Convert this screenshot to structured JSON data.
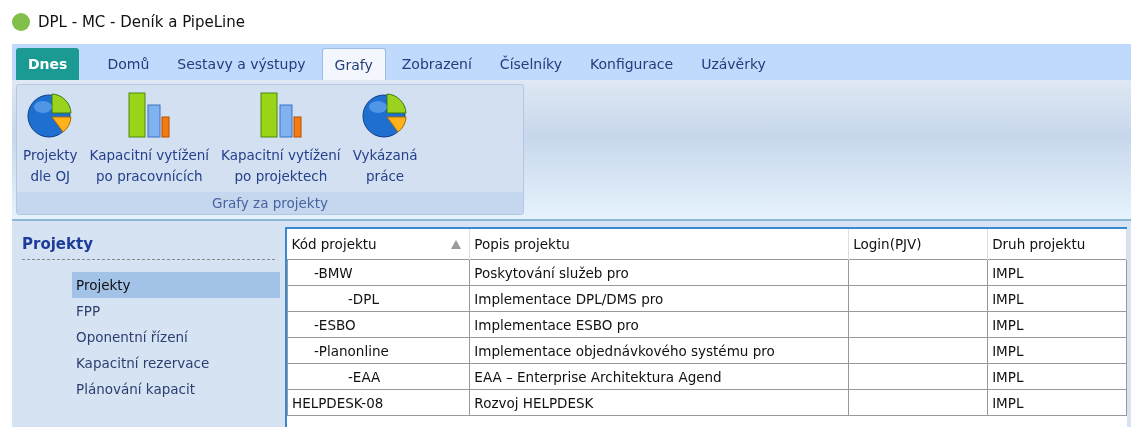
{
  "window": {
    "title": "DPL - MC - Deník a PipeLine"
  },
  "tabs": [
    {
      "label": "Dnes",
      "kind": "app",
      "selected": false
    },
    {
      "label": "Domů",
      "kind": "tab",
      "selected": false
    },
    {
      "label": "Sestavy a výstupy",
      "kind": "tab",
      "selected": false
    },
    {
      "label": "Grafy",
      "kind": "tab",
      "selected": true
    },
    {
      "label": "Zobrazení",
      "kind": "tab",
      "selected": false
    },
    {
      "label": "Číselníky",
      "kind": "tab",
      "selected": false
    },
    {
      "label": "Konfigurace",
      "kind": "tab",
      "selected": false
    },
    {
      "label": "Uzávěrky",
      "kind": "tab",
      "selected": false
    }
  ],
  "ribbon": {
    "groups": [
      {
        "label": "Grafy za projekty",
        "buttons": [
          {
            "label": "Projekty\ndle OJ",
            "kind": "pie"
          },
          {
            "label": "Kapacitní vytížení\npo pracovnících",
            "kind": "bar"
          },
          {
            "label": "Kapacitní vytížení\npo projektech",
            "kind": "bar"
          },
          {
            "label": "Vykázaná\npráce",
            "kind": "pie"
          }
        ]
      }
    ]
  },
  "sidebar": {
    "title": "Projekty",
    "items": [
      {
        "label": "Projekty",
        "selected": true
      },
      {
        "label": "FPP",
        "selected": false
      },
      {
        "label": "Oponentní řízení",
        "selected": false
      },
      {
        "label": "Kapacitní rezervace",
        "selected": false
      },
      {
        "label": "Plánování kapacit",
        "selected": false
      }
    ]
  },
  "table": {
    "columns": [
      {
        "label": "Kód projektu",
        "sorted": true
      },
      {
        "label": "Popis projektu"
      },
      {
        "label": "Login(PJV)"
      },
      {
        "label": "Druh projektu"
      }
    ],
    "rows": [
      {
        "kind": "sub",
        "cells": [
          "-BMW",
          "Poskytování služeb pro",
          "",
          "IMPL"
        ],
        "children": [
          {
            "kind": "sub",
            "cells": [
              "-DPL",
              "Implementace DPL/DMS pro",
              "",
              "IMPL"
            ]
          }
        ]
      },
      {
        "kind": "sub",
        "cells": [
          "-ESBO",
          "Implementace ESBO pro",
          "",
          "IMPL"
        ]
      },
      {
        "kind": "sub",
        "cells": [
          "-Planonline",
          "Implementace objednávkového systému pro",
          "",
          "IMPL"
        ],
        "children": [
          {
            "kind": "sub",
            "cells": [
              "-EAA",
              "EAA – Enterprise Architektura Agend",
              "",
              "IMPL"
            ]
          }
        ]
      },
      {
        "kind": "project",
        "cells": [
          "HELPDESK-08",
          "Rozvoj HELPDESK",
          "",
          "IMPL"
        ]
      }
    ]
  }
}
